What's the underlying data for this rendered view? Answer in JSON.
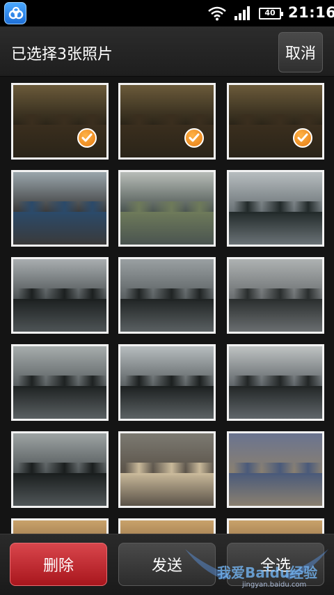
{
  "status_bar": {
    "app_icon": "baidu-cloud-icon",
    "wifi_icon": "wifi-icon",
    "signal_icon": "signal-icon",
    "battery_level": "40",
    "time": "21:16"
  },
  "header": {
    "title": "已选择3张照片",
    "cancel_label": "取消"
  },
  "photos": [
    {
      "id": "photo-1",
      "selected": true
    },
    {
      "id": "photo-2",
      "selected": true
    },
    {
      "id": "photo-3",
      "selected": true
    },
    {
      "id": "photo-4",
      "selected": false
    },
    {
      "id": "photo-5",
      "selected": false
    },
    {
      "id": "photo-6",
      "selected": false
    },
    {
      "id": "photo-7",
      "selected": false
    },
    {
      "id": "photo-8",
      "selected": false
    },
    {
      "id": "photo-9",
      "selected": false
    },
    {
      "id": "photo-10",
      "selected": false
    },
    {
      "id": "photo-11",
      "selected": false
    },
    {
      "id": "photo-12",
      "selected": false
    },
    {
      "id": "photo-13",
      "selected": false
    },
    {
      "id": "photo-14",
      "selected": false
    },
    {
      "id": "photo-15",
      "selected": false
    }
  ],
  "toolbar": {
    "delete_label": "删除",
    "send_label": "发送",
    "select_all_label": "全选"
  },
  "watermark": {
    "main": "我爱Baidu经验",
    "sub": "jingyan.baidu.com"
  },
  "colors": {
    "delete_red": "#c0262d",
    "check_orange": "#f39a2a",
    "background": "#141414"
  }
}
